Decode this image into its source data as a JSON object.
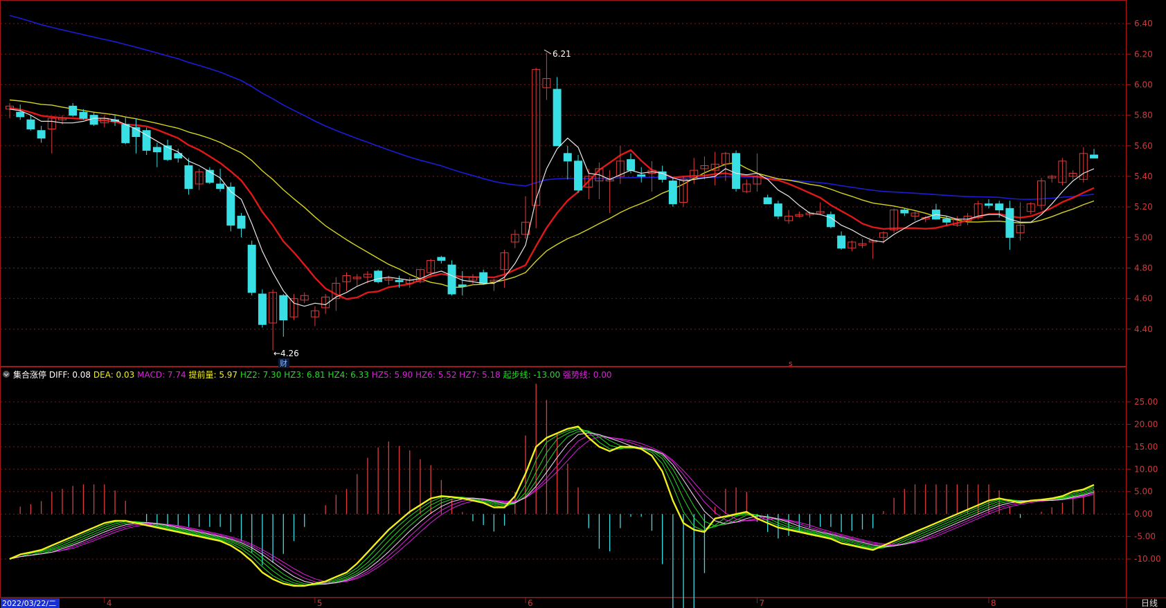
{
  "colors": {
    "background": "#000000",
    "frame": "#a01818",
    "grid": "#7a1a1a",
    "axis_text": "#d23a3a",
    "up_candle": "#e03c3c",
    "down_candle": "#38e0e6",
    "ma5": "#e8e8e8",
    "ma10": "#e01818",
    "ma20": "#d6d61e",
    "ma60": "#1c1cd6",
    "diff": "#f0f01c",
    "dea": "#e0e0e0",
    "hz_green": "#22dd22",
    "hz_magenta": "#dd22dd"
  },
  "price_axis": {
    "min": 4.2,
    "max": 6.5,
    "ticks": [
      "6.40",
      "6.20",
      "6.00",
      "5.80",
      "5.60",
      "5.40",
      "5.20",
      "5.00",
      "4.80",
      "4.60",
      "4.40"
    ]
  },
  "indicator_axis": {
    "min": -18,
    "max": 29,
    "ticks": [
      "25.00",
      "20.00",
      "15.00",
      "10.00",
      "5.00",
      "0.00",
      "-5.00",
      "-10.00"
    ]
  },
  "date_axis": {
    "first_date": "2022/03/22/二",
    "months": [
      {
        "label": "4",
        "i": 9
      },
      {
        "label": "5",
        "i": 29
      },
      {
        "label": "6",
        "i": 49
      },
      {
        "label": "7",
        "i": 71
      },
      {
        "label": "8",
        "i": 93
      }
    ],
    "period": "日线"
  },
  "annotations": {
    "low": "←4.26",
    "high": "6.21",
    "cai_mark": "财",
    "s_mark": "s"
  },
  "indicator_header": {
    "name": "集合涨停",
    "items": [
      {
        "label": "DIFF:",
        "value": "0.08",
        "color": "#ffffff"
      },
      {
        "label": "DEA:",
        "value": "0.03",
        "color": "#f0f01c"
      },
      {
        "label": "MACD:",
        "value": "7.74",
        "color": "#dd22dd"
      },
      {
        "label": "提前量:",
        "value": "5.97",
        "color": "#f0f01c"
      },
      {
        "label": "HZ2:",
        "value": "7.30",
        "color": "#22dd22"
      },
      {
        "label": "HZ3:",
        "value": "6.81",
        "color": "#22dd22"
      },
      {
        "label": "HZ4:",
        "value": "6.33",
        "color": "#22dd22"
      },
      {
        "label": "HZ5:",
        "value": "5.90",
        "color": "#dd22dd"
      },
      {
        "label": "HZ6:",
        "value": "5.52",
        "color": "#dd22dd"
      },
      {
        "label": "HZ7:",
        "value": "5.18",
        "color": "#dd22dd"
      },
      {
        "label": "起步线:",
        "value": "-13.00",
        "color": "#22dd22"
      },
      {
        "label": "强势线:",
        "value": "0.00",
        "color": "#dd22dd"
      }
    ]
  },
  "chart_data": {
    "type": "candlestick",
    "candles": [
      [
        5.84,
        5.88,
        5.78,
        5.86
      ],
      [
        5.82,
        5.87,
        5.77,
        5.79
      ],
      [
        5.77,
        5.8,
        5.7,
        5.71
      ],
      [
        5.7,
        5.73,
        5.62,
        5.65
      ],
      [
        5.71,
        5.78,
        5.55,
        5.78
      ],
      [
        5.77,
        5.8,
        5.74,
        5.78
      ],
      [
        5.86,
        5.88,
        5.79,
        5.8
      ],
      [
        5.82,
        5.84,
        5.77,
        5.78
      ],
      [
        5.8,
        5.82,
        5.73,
        5.74
      ],
      [
        5.75,
        5.8,
        5.72,
        5.78
      ],
      [
        5.77,
        5.8,
        5.73,
        5.76
      ],
      [
        5.74,
        5.79,
        5.61,
        5.62
      ],
      [
        5.72,
        5.78,
        5.55,
        5.66
      ],
      [
        5.7,
        5.72,
        5.54,
        5.57
      ],
      [
        5.59,
        5.62,
        5.46,
        5.56
      ],
      [
        5.6,
        5.64,
        5.5,
        5.51
      ],
      [
        5.55,
        5.58,
        5.49,
        5.52
      ],
      [
        5.47,
        5.52,
        5.28,
        5.32
      ],
      [
        5.35,
        5.45,
        5.31,
        5.43
      ],
      [
        5.44,
        5.46,
        5.35,
        5.36
      ],
      [
        5.35,
        5.45,
        5.3,
        5.32
      ],
      [
        5.33,
        5.36,
        5.04,
        5.08
      ],
      [
        5.14,
        5.16,
        5.0,
        5.06
      ],
      [
        4.95,
        4.98,
        4.62,
        4.64
      ],
      [
        4.63,
        4.66,
        4.41,
        4.43
      ],
      [
        4.44,
        4.66,
        4.26,
        4.64
      ],
      [
        4.62,
        4.63,
        4.35,
        4.46
      ],
      [
        4.48,
        4.63,
        4.46,
        4.6
      ],
      [
        4.59,
        4.64,
        4.57,
        4.62
      ],
      [
        4.48,
        4.55,
        4.42,
        4.52
      ],
      [
        4.54,
        4.63,
        4.5,
        4.61
      ],
      [
        4.6,
        4.74,
        4.52,
        4.7
      ],
      [
        4.71,
        4.77,
        4.65,
        4.75
      ],
      [
        4.73,
        4.76,
        4.68,
        4.74
      ],
      [
        4.74,
        4.78,
        4.7,
        4.76
      ],
      [
        4.78,
        4.79,
        4.7,
        4.71
      ],
      [
        4.72,
        4.75,
        4.69,
        4.73
      ],
      [
        4.72,
        4.75,
        4.67,
        4.71
      ],
      [
        4.7,
        4.74,
        4.67,
        4.72
      ],
      [
        4.71,
        4.79,
        4.7,
        4.79
      ],
      [
        4.77,
        4.86,
        4.75,
        4.85
      ],
      [
        4.87,
        4.88,
        4.83,
        4.85
      ],
      [
        4.82,
        4.85,
        4.62,
        4.63
      ],
      [
        4.69,
        4.78,
        4.62,
        4.68
      ],
      [
        4.72,
        4.76,
        4.69,
        4.74
      ],
      [
        4.77,
        4.79,
        4.69,
        4.7
      ],
      [
        4.71,
        4.73,
        4.65,
        4.72
      ],
      [
        4.79,
        4.92,
        4.67,
        4.9
      ],
      [
        4.97,
        5.05,
        4.93,
        5.02
      ],
      [
        5.02,
        5.27,
        4.99,
        5.1
      ],
      [
        5.21,
        6.11,
        5.06,
        6.1
      ],
      [
        5.98,
        6.21,
        5.9,
        6.04
      ],
      [
        5.97,
        6.05,
        5.83,
        5.6
      ],
      [
        5.55,
        5.6,
        5.38,
        5.5
      ],
      [
        5.5,
        5.54,
        5.29,
        5.31
      ],
      [
        5.33,
        5.45,
        5.25,
        5.4
      ],
      [
        5.37,
        5.49,
        5.25,
        5.45
      ],
      [
        5.37,
        5.44,
        5.16,
        5.38
      ],
      [
        5.4,
        5.6,
        5.35,
        5.5
      ],
      [
        5.51,
        5.55,
        5.42,
        5.44
      ],
      [
        5.41,
        5.46,
        5.36,
        5.4
      ],
      [
        5.42,
        5.5,
        5.3,
        5.44
      ],
      [
        5.43,
        5.47,
        5.36,
        5.38
      ],
      [
        5.37,
        5.39,
        5.2,
        5.22
      ],
      [
        5.23,
        5.4,
        5.2,
        5.38
      ],
      [
        5.39,
        5.52,
        5.35,
        5.44
      ],
      [
        5.45,
        5.53,
        5.38,
        5.47
      ],
      [
        5.44,
        5.56,
        5.34,
        5.48
      ],
      [
        5.48,
        5.56,
        5.37,
        5.55
      ],
      [
        5.55,
        5.57,
        5.3,
        5.32
      ],
      [
        5.3,
        5.38,
        5.29,
        5.35
      ],
      [
        5.35,
        5.55,
        5.3,
        5.4
      ],
      [
        5.26,
        5.28,
        5.22,
        5.22
      ],
      [
        5.22,
        5.24,
        5.12,
        5.14
      ],
      [
        5.11,
        5.18,
        5.09,
        5.14
      ],
      [
        5.14,
        5.17,
        5.13,
        5.15
      ],
      [
        5.15,
        5.17,
        5.13,
        5.16
      ],
      [
        5.16,
        5.23,
        5.15,
        5.17
      ],
      [
        5.15,
        5.17,
        5.06,
        5.07
      ],
      [
        5.01,
        5.04,
        4.92,
        4.93
      ],
      [
        4.93,
        4.98,
        4.91,
        4.97
      ],
      [
        4.95,
        4.99,
        4.93,
        4.96
      ],
      [
        4.97,
        4.99,
        4.86,
        4.98
      ],
      [
        5.0,
        5.04,
        4.96,
        5.03
      ],
      [
        5.05,
        5.19,
        5.03,
        5.18
      ],
      [
        5.18,
        5.19,
        5.14,
        5.16
      ],
      [
        5.14,
        5.17,
        5.11,
        5.16
      ],
      [
        5.12,
        5.14,
        5.1,
        5.13
      ],
      [
        5.18,
        5.22,
        5.12,
        5.12
      ],
      [
        5.12,
        5.14,
        5.08,
        5.1
      ],
      [
        5.08,
        5.14,
        5.07,
        5.12
      ],
      [
        5.11,
        5.16,
        5.08,
        5.14
      ],
      [
        5.13,
        5.24,
        5.12,
        5.22
      ],
      [
        5.22,
        5.25,
        5.19,
        5.21
      ],
      [
        5.22,
        5.24,
        5.13,
        5.18
      ],
      [
        5.19,
        5.24,
        4.92,
        5.0
      ],
      [
        5.03,
        5.23,
        4.98,
        5.08
      ],
      [
        5.17,
        5.23,
        5.15,
        5.22
      ],
      [
        5.21,
        5.39,
        5.18,
        5.37
      ],
      [
        5.39,
        5.41,
        5.36,
        5.4
      ],
      [
        5.36,
        5.52,
        5.34,
        5.5
      ],
      [
        5.4,
        5.44,
        5.38,
        5.42
      ],
      [
        5.38,
        5.59,
        5.36,
        5.55
      ],
      [
        5.54,
        5.58,
        5.52,
        5.52
      ]
    ],
    "ma5": [
      5.84,
      5.83,
      5.8,
      5.76,
      5.76,
      5.75,
      5.75,
      5.76,
      5.78,
      5.78,
      5.77,
      5.74,
      5.71,
      5.67,
      5.63,
      5.59,
      5.56,
      5.5,
      5.47,
      5.43,
      5.39,
      5.3,
      5.25,
      5.09,
      4.91,
      4.77,
      4.65,
      4.57,
      4.55,
      4.57,
      4.56,
      4.61,
      4.64,
      4.68,
      4.71,
      4.73,
      4.74,
      4.73,
      4.72,
      4.73,
      4.76,
      4.78,
      4.75,
      4.72,
      4.71,
      4.7,
      4.7,
      4.74,
      4.83,
      4.95,
      5.25,
      5.45,
      5.58,
      5.65,
      5.59,
      5.42,
      5.41,
      5.38,
      5.41,
      5.44,
      5.42,
      5.43,
      5.42,
      5.39,
      5.37,
      5.38,
      5.39,
      5.4,
      5.45,
      5.42,
      5.41,
      5.42,
      5.38,
      5.31,
      5.27,
      5.21,
      5.16,
      5.15,
      5.13,
      5.08,
      5.05,
      5.01,
      4.98,
      4.97,
      5.02,
      5.06,
      5.1,
      5.13,
      5.15,
      5.14,
      5.12,
      5.12,
      5.14,
      5.15,
      5.15,
      5.12,
      5.1,
      5.1,
      5.15,
      5.22,
      5.3,
      5.37,
      5.42,
      5.45
    ]
  },
  "macd_data": {
    "diff": [
      -10,
      -9,
      -8.5,
      -8,
      -7,
      -6,
      -5,
      -4,
      -3,
      -2,
      -1.5,
      -1.5,
      -2,
      -2.5,
      -3,
      -3.5,
      -4,
      -4.5,
      -5,
      -5.5,
      -6,
      -7,
      -8.5,
      -10.5,
      -13,
      -14.5,
      -15.5,
      -16,
      -16,
      -15.5,
      -15,
      -14,
      -13,
      -11,
      -8.5,
      -6,
      -3.5,
      -1.5,
      0.5,
      2,
      3.5,
      4,
      3.8,
      3.5,
      3,
      2.5,
      1.5,
      1.5,
      4,
      9,
      15,
      17,
      18,
      19,
      19.5,
      17,
      15,
      14,
      15,
      15,
      14.5,
      13,
      9.5,
      3,
      -2,
      -3.5,
      -4,
      -1,
      -0.5,
      0,
      0.5,
      -1,
      -2,
      -3,
      -3.5,
      -4,
      -4.5,
      -5,
      -5.5,
      -6.5,
      -7,
      -7.5,
      -8,
      -7,
      -6,
      -5,
      -4,
      -3,
      -2,
      -1,
      0,
      1,
      2,
      3,
      3.5,
      3,
      2.5,
      3,
      3.2,
      3.5,
      4,
      5,
      5.5,
      6.5
    ]
  }
}
